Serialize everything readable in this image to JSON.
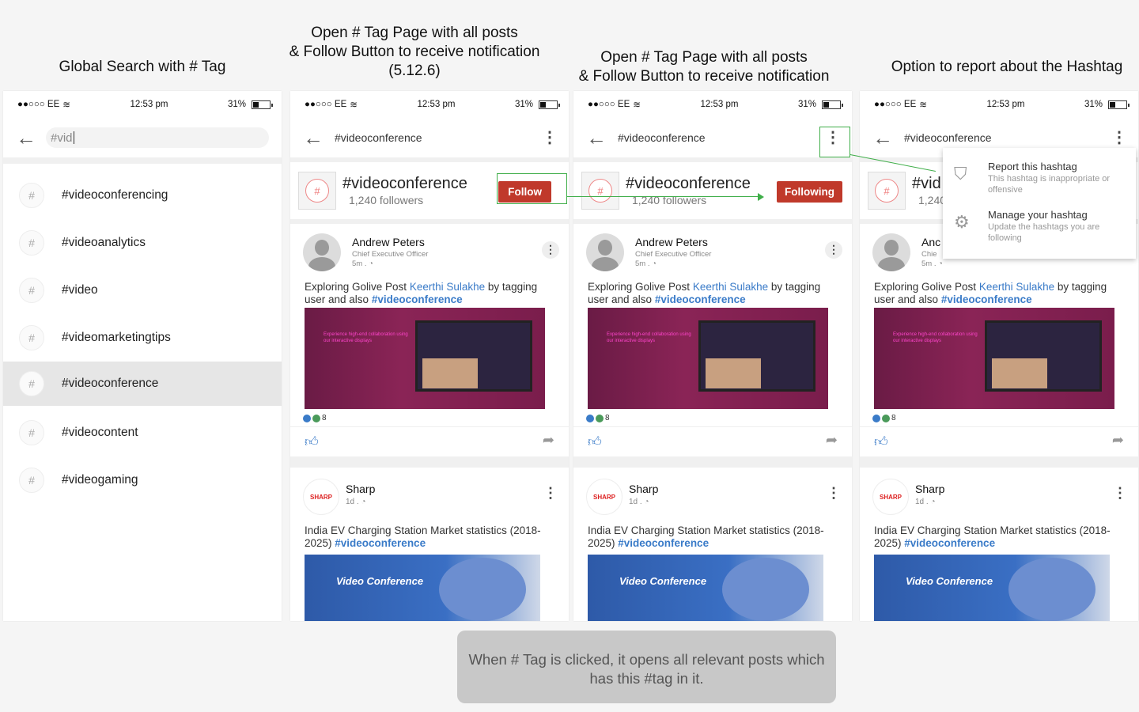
{
  "captions": {
    "c1": "Global Search  with # Tag",
    "c2_line1": "Open # Tag Page with all posts",
    "c2_line2": "& Follow Button to receive notification",
    "c2_line3": "(5.12.6)",
    "c3_line1": "Open # Tag Page with all posts",
    "c3_line2": "& Follow Button to receive notification",
    "c4": "Option to report about the Hashtag"
  },
  "statusbar": {
    "carrier": "●●○○○ EE",
    "wifi_icon": "wifi-icon",
    "time": "12:53 pm",
    "battery": "31%"
  },
  "search": {
    "query": "#vid",
    "results": [
      "#videoconferencing",
      "#videoanalytics",
      "#video",
      "#videomarketingtips",
      "#videoconference",
      "#videocontent",
      "#videogaming"
    ],
    "active_index": 4
  },
  "tag_page": {
    "appbar_title": "#videoconference",
    "tag_name": "#videoconference",
    "followers": "1,240 followers",
    "follow_label": "Follow",
    "following_label": "Following",
    "tag_name_truncated": "#vid",
    "followers_truncated": "1,240"
  },
  "post1": {
    "author": "Andrew Peters",
    "role": "Chief Executive Officer",
    "time": "5m .",
    "text_pre": "Exploring Golive Post ",
    "mention": "Keerthi Sulakhe",
    "text_mid": " by tagging user and also ",
    "hashtag": "#videoconference",
    "reaction_count": "8",
    "image_text": "Experience high-end collaboration using our interactive displays",
    "author_truncated": "Anc",
    "role_truncated": "Chie"
  },
  "post2": {
    "author": "Sharp",
    "logo": "SHARP",
    "time": "1d .",
    "text": "India EV Charging Station Market statistics (2018-2025) ",
    "hashtag": "#videoconference",
    "image_title": "Video Conference"
  },
  "menu": {
    "report_title": "Report this hashtag",
    "report_sub": "This hashtag is inappropriate or offensive",
    "manage_title": "Manage your hashtag",
    "manage_sub": "Update the hashtags you are following"
  },
  "note": "When # Tag is clicked, it opens all relevant posts which has this #tag in it.",
  "colors": {
    "accent_red": "#c0392b",
    "link_blue": "#3a7bc8",
    "annotation_green": "#3fae49"
  }
}
